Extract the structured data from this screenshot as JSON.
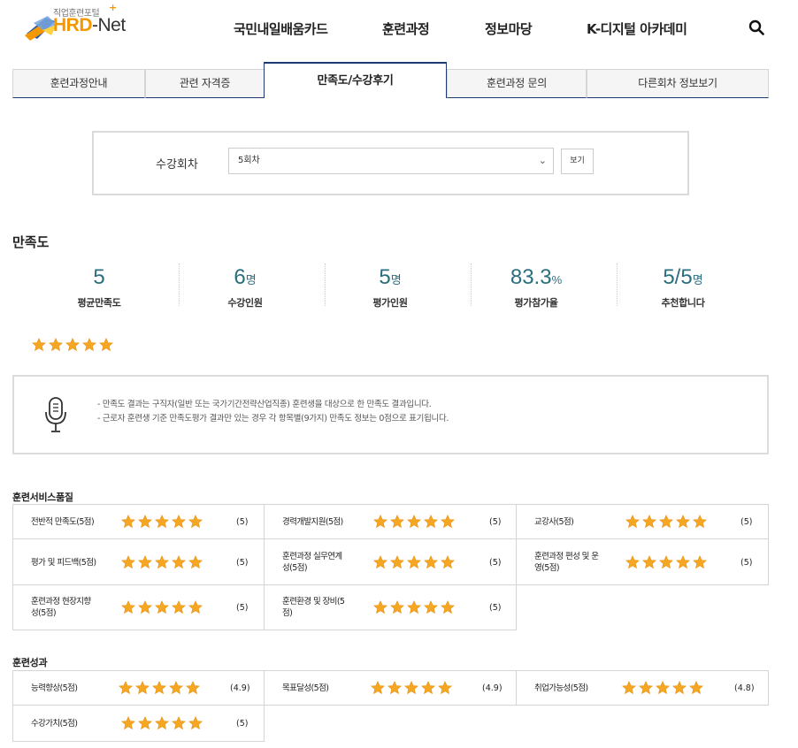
{
  "header": {
    "logo_sub": "직업훈련포털",
    "logo_plus": "+",
    "logo_main_hrd": "HRD",
    "logo_main_dash": "-",
    "logo_main_net": "Net",
    "nav": [
      "국민내일배움카드",
      "훈련과정",
      "정보마당",
      "K-디지털 아카데미"
    ],
    "search_icon": "search-icon"
  },
  "tabs": [
    "훈련과정안내",
    "관련 자격증",
    "만족도/수강후기",
    "훈련과정 문의",
    "다른회차 정보보기"
  ],
  "active_tab": 2,
  "filter": {
    "label": "수강회차",
    "selected": "5회차",
    "button": "보기"
  },
  "satisfaction": {
    "title": "만족도",
    "stats": [
      {
        "value": "5",
        "unit": "",
        "label": "평균만족도"
      },
      {
        "value": "6",
        "unit": "명",
        "label": "수강인원"
      },
      {
        "value": "5",
        "unit": "명",
        "label": "평가인원"
      },
      {
        "value": "83.3",
        "unit": "%",
        "label": "평가참가율"
      },
      {
        "value": "5/5",
        "unit": "명",
        "label": "추천합니다"
      }
    ],
    "overall_stars": 5
  },
  "notice": {
    "icon": "microphone-icon",
    "lines": [
      "- 만족도 결과는 구직자(일반 또는 국가기간전략산업직종) 훈련생을 대상으로 한 만족도 결과입니다.",
      "- 근로자 훈련생 기준 만족도평가 결과만 있는 경우 각 항목별(9가지) 만족도 정보는 0점으로 표기됩니다."
    ]
  },
  "service_quality": {
    "title": "훈련서비스품질",
    "items": [
      {
        "label": "전반적 만족도(5점)",
        "score": "(5)",
        "stars": 5
      },
      {
        "label": "경력개발지원(5점)",
        "score": "(5)",
        "stars": 5
      },
      {
        "label": "교강사(5점)",
        "score": "(5)",
        "stars": 5
      },
      {
        "label": "평가 및 피드백(5점)",
        "score": "(5)",
        "stars": 5
      },
      {
        "label": "훈련과정 실무연계성(5점)",
        "label_l1": "훈련과정 실무연계",
        "label_l2": "성(5점)",
        "score": "(5)",
        "stars": 5
      },
      {
        "label": "훈련과정 편성 및 운영(5점)",
        "label_l1": "훈련과정 편성 및 운",
        "label_l2": "영(5점)",
        "score": "(5)",
        "stars": 5
      },
      {
        "label": "훈련과정 현장지향성(5점)",
        "label_l1": "훈련과정 현장지향",
        "label_l2": "성(5점)",
        "score": "(5)",
        "stars": 5
      },
      {
        "label": "훈련환경 및 장비(5점)",
        "label_l1": "훈련환경 및 장비(5",
        "label_l2": "점)",
        "score": "(5)",
        "stars": 5
      }
    ]
  },
  "outcomes": {
    "title": "훈련성과",
    "items": [
      {
        "label": "능력향상(5점)",
        "score": "(4.9)",
        "stars": 5
      },
      {
        "label": "목표달성(5점)",
        "score": "(4.9)",
        "stars": 5
      },
      {
        "label": "취업가능성(5점)",
        "score": "(4.8)",
        "stars": 5
      },
      {
        "label": "수강가치(5점)",
        "score": "(5)",
        "stars": 5
      }
    ]
  },
  "colors": {
    "accent_teal": "#2b6e7e",
    "tab_border": "#1f3a73",
    "star": "#f5a623",
    "logo_orange": "#f39800"
  }
}
